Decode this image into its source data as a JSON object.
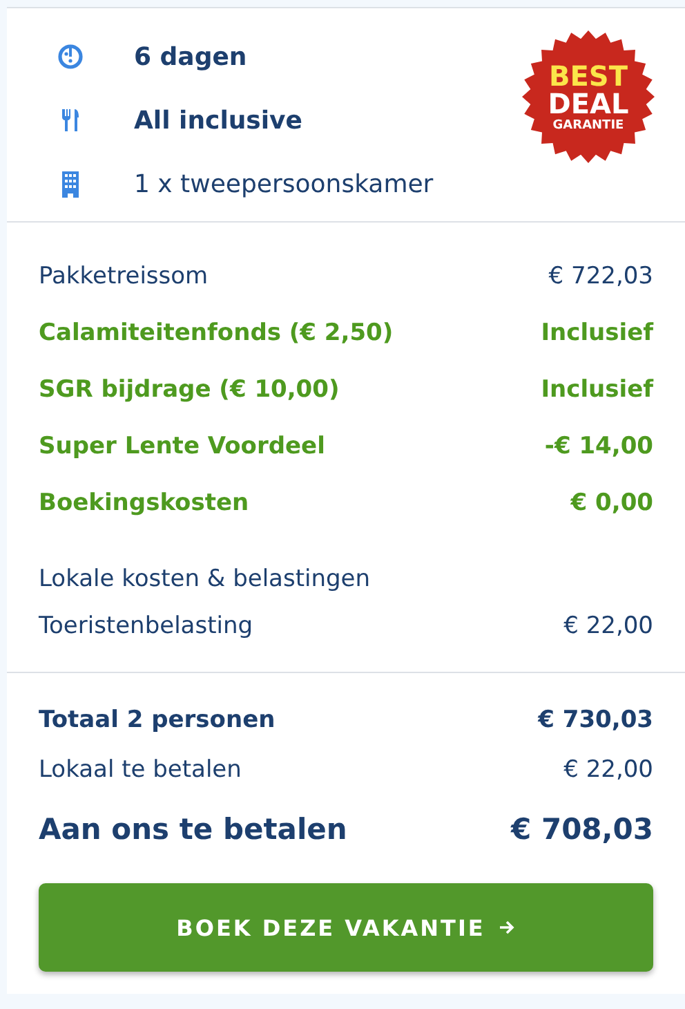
{
  "features": [
    {
      "kind": "clock",
      "label": "6 dagen",
      "bold": true
    },
    {
      "kind": "cutlery",
      "label": "All inclusive",
      "bold": true
    },
    {
      "kind": "building",
      "label": "1 x tweepersoonskamer",
      "bold": false
    }
  ],
  "badge": {
    "lines": [
      "BEST",
      "DEAL",
      "GARANTIE"
    ]
  },
  "price_lines": [
    {
      "kind": "regular",
      "label": "Pakketreissom",
      "value": "€ 722,03"
    },
    {
      "kind": "discount",
      "label": "Calamiteitenfonds (€ 2,50)",
      "value": "Inclusief"
    },
    {
      "kind": "discount",
      "label": "SGR bijdrage (€ 10,00)",
      "value": "Inclusief"
    },
    {
      "kind": "discount",
      "label": "Super Lente Voordeel",
      "value": "-€ 14,00"
    },
    {
      "kind": "discount",
      "label": "Boekingskosten",
      "value": "€ 0,00"
    }
  ],
  "local_costs": {
    "heading": "Lokale kosten & belastingen",
    "items": [
      {
        "label": "Toeristenbelasting",
        "value": "€ 22,00"
      }
    ]
  },
  "totals": [
    {
      "kind": "total",
      "label": "Totaal 2 personen",
      "value": "€ 730,03"
    },
    {
      "kind": "local",
      "label": "Lokaal te betalen",
      "value": "€ 22,00"
    },
    {
      "kind": "grand",
      "label": "Aan ons te betalen",
      "value": "€ 708,03"
    }
  ],
  "book_button": {
    "label": "BOEK DEZE VAKANTIE"
  }
}
